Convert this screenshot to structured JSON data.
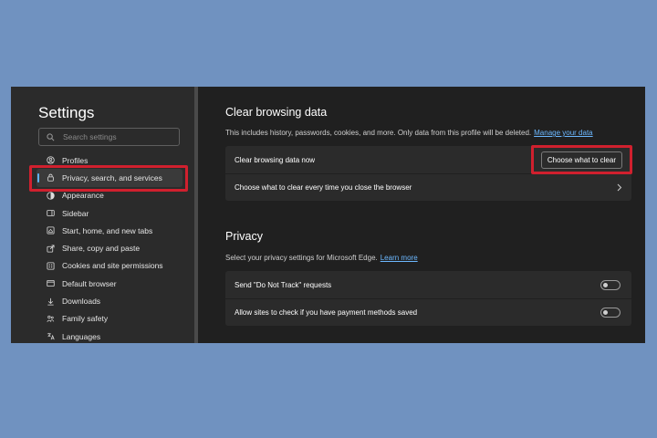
{
  "sidebar": {
    "title": "Settings",
    "search_placeholder": "Search settings",
    "items": [
      {
        "label": "Profiles",
        "icon": "profile-icon"
      },
      {
        "label": "Privacy, search, and services",
        "icon": "lock-icon",
        "active": true
      },
      {
        "label": "Appearance",
        "icon": "appearance-icon"
      },
      {
        "label": "Sidebar",
        "icon": "sidebar-icon"
      },
      {
        "label": "Start, home, and new tabs",
        "icon": "home-icon"
      },
      {
        "label": "Share, copy and paste",
        "icon": "share-icon"
      },
      {
        "label": "Cookies and site permissions",
        "icon": "cookies-icon"
      },
      {
        "label": "Default browser",
        "icon": "browser-icon"
      },
      {
        "label": "Downloads",
        "icon": "download-icon"
      },
      {
        "label": "Family safety",
        "icon": "family-icon"
      },
      {
        "label": "Languages",
        "icon": "languages-icon"
      }
    ]
  },
  "clear_data": {
    "title": "Clear browsing data",
    "description": "This includes history, passwords, cookies, and more. Only data from this profile will be deleted.",
    "manage_link": "Manage your data",
    "row_now": "Clear browsing data now",
    "button": "Choose what to clear",
    "row_on_close": "Choose what to clear every time you close the browser"
  },
  "privacy": {
    "title": "Privacy",
    "description": "Select your privacy settings for Microsoft Edge.",
    "learn_more": "Learn more",
    "dnt_label": "Send \"Do Not Track\" requests",
    "dnt_on": false,
    "payment_label": "Allow sites to check if you have payment methods saved",
    "payment_on": false
  },
  "colors": {
    "background": "#7092c0",
    "highlight": "#d0202e",
    "link": "#6cb8ff",
    "accent": "#5fb2f2"
  }
}
